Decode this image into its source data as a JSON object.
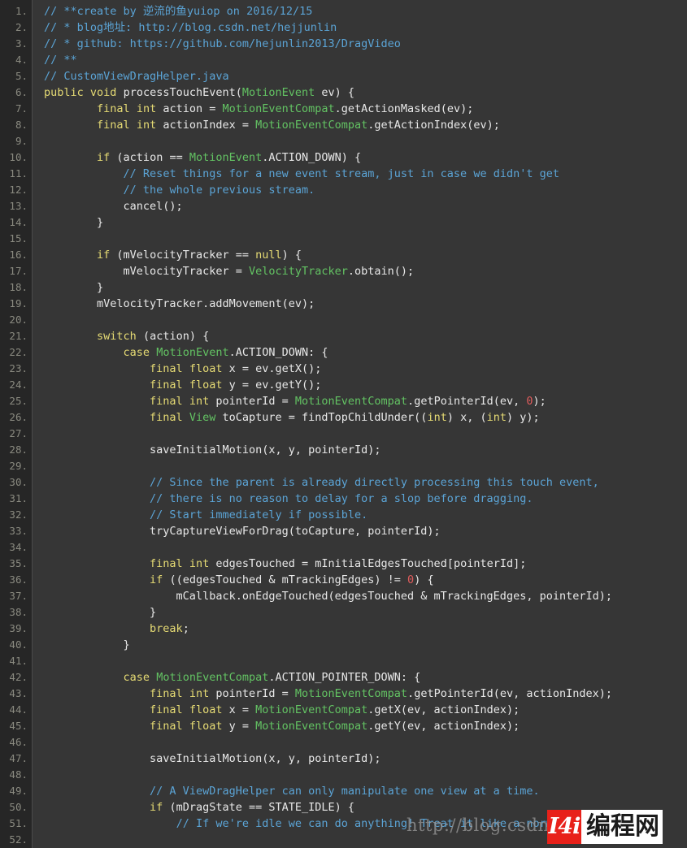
{
  "editor": {
    "title": "CustomViewDragHelper.java",
    "language": "Java",
    "theme": "dark",
    "colors": {
      "background": "#363636",
      "gutter_background": "#262626",
      "gutter_text": "#8a8a80",
      "plain_text": "#e8e8e8",
      "comment": "#5ba4d6",
      "keyword": "#e6db74",
      "type": "#63c363",
      "number": "#e05c5c"
    },
    "first_line_number": 1,
    "last_line_number": 52,
    "total_lines_shown": 52
  },
  "watermark": {
    "url_text": "http://blog.csdn.n",
    "logo_mark": "I4i",
    "logo_text": "编程网",
    "logo_background": "#e8211a"
  },
  "lines": [
    {
      "n": "1.",
      "tokens": [
        {
          "t": "cmt",
          "s": "// **create by 逆流的鱼yuiop on 2016/12/15"
        }
      ]
    },
    {
      "n": "2.",
      "tokens": [
        {
          "t": "cmt",
          "s": "// * blog地址: http://blog.csdn.net/hejjunlin"
        }
      ]
    },
    {
      "n": "3.",
      "tokens": [
        {
          "t": "cmt",
          "s": "// * github: https://github.com/hejunlin2013/DragVideo"
        }
      ]
    },
    {
      "n": "4.",
      "tokens": [
        {
          "t": "cmt",
          "s": "// **"
        }
      ]
    },
    {
      "n": "5.",
      "tokens": [
        {
          "t": "cmt",
          "s": "// CustomViewDragHelper.java"
        }
      ]
    },
    {
      "n": "6.",
      "tokens": [
        {
          "t": "kw",
          "s": "public"
        },
        {
          "t": "pln",
          "s": " "
        },
        {
          "t": "kw",
          "s": "void"
        },
        {
          "t": "pln",
          "s": " processTouchEvent("
        },
        {
          "t": "typ",
          "s": "MotionEvent"
        },
        {
          "t": "pln",
          "s": " ev) {"
        }
      ]
    },
    {
      "n": "7.",
      "tokens": [
        {
          "t": "pln",
          "s": "        "
        },
        {
          "t": "kw",
          "s": "final"
        },
        {
          "t": "pln",
          "s": " "
        },
        {
          "t": "kw",
          "s": "int"
        },
        {
          "t": "pln",
          "s": " action = "
        },
        {
          "t": "typ",
          "s": "MotionEventCompat"
        },
        {
          "t": "pln",
          "s": ".getActionMasked(ev);"
        }
      ]
    },
    {
      "n": "8.",
      "tokens": [
        {
          "t": "pln",
          "s": "        "
        },
        {
          "t": "kw",
          "s": "final"
        },
        {
          "t": "pln",
          "s": " "
        },
        {
          "t": "kw",
          "s": "int"
        },
        {
          "t": "pln",
          "s": " actionIndex = "
        },
        {
          "t": "typ",
          "s": "MotionEventCompat"
        },
        {
          "t": "pln",
          "s": ".getActionIndex(ev);"
        }
      ]
    },
    {
      "n": "9.",
      "tokens": [
        {
          "t": "pln",
          "s": ""
        }
      ]
    },
    {
      "n": "10.",
      "tokens": [
        {
          "t": "pln",
          "s": "        "
        },
        {
          "t": "kw",
          "s": "if"
        },
        {
          "t": "pln",
          "s": " (action == "
        },
        {
          "t": "typ",
          "s": "MotionEvent"
        },
        {
          "t": "pln",
          "s": ".ACTION_DOWN) {"
        }
      ]
    },
    {
      "n": "11.",
      "tokens": [
        {
          "t": "pln",
          "s": "            "
        },
        {
          "t": "cmt",
          "s": "// Reset things for a new event stream, just in case we didn't get"
        }
      ]
    },
    {
      "n": "12.",
      "tokens": [
        {
          "t": "pln",
          "s": "            "
        },
        {
          "t": "cmt",
          "s": "// the whole previous stream."
        }
      ]
    },
    {
      "n": "13.",
      "tokens": [
        {
          "t": "pln",
          "s": "            cancel();"
        }
      ]
    },
    {
      "n": "14.",
      "tokens": [
        {
          "t": "pln",
          "s": "        }"
        }
      ]
    },
    {
      "n": "15.",
      "tokens": [
        {
          "t": "pln",
          "s": ""
        }
      ]
    },
    {
      "n": "16.",
      "tokens": [
        {
          "t": "pln",
          "s": "        "
        },
        {
          "t": "kw",
          "s": "if"
        },
        {
          "t": "pln",
          "s": " (mVelocityTracker == "
        },
        {
          "t": "kw",
          "s": "null"
        },
        {
          "t": "pln",
          "s": ") {"
        }
      ]
    },
    {
      "n": "17.",
      "tokens": [
        {
          "t": "pln",
          "s": "            mVelocityTracker = "
        },
        {
          "t": "typ",
          "s": "VelocityTracker"
        },
        {
          "t": "pln",
          "s": ".obtain();"
        }
      ]
    },
    {
      "n": "18.",
      "tokens": [
        {
          "t": "pln",
          "s": "        }"
        }
      ]
    },
    {
      "n": "19.",
      "tokens": [
        {
          "t": "pln",
          "s": "        mVelocityTracker.addMovement(ev);"
        }
      ]
    },
    {
      "n": "20.",
      "tokens": [
        {
          "t": "pln",
          "s": ""
        }
      ]
    },
    {
      "n": "21.",
      "tokens": [
        {
          "t": "pln",
          "s": "        "
        },
        {
          "t": "kw",
          "s": "switch"
        },
        {
          "t": "pln",
          "s": " (action) {"
        }
      ]
    },
    {
      "n": "22.",
      "tokens": [
        {
          "t": "pln",
          "s": "            "
        },
        {
          "t": "kw",
          "s": "case"
        },
        {
          "t": "pln",
          "s": " "
        },
        {
          "t": "typ",
          "s": "MotionEvent"
        },
        {
          "t": "pln",
          "s": ".ACTION_DOWN: {"
        }
      ]
    },
    {
      "n": "23.",
      "tokens": [
        {
          "t": "pln",
          "s": "                "
        },
        {
          "t": "kw",
          "s": "final"
        },
        {
          "t": "pln",
          "s": " "
        },
        {
          "t": "kw",
          "s": "float"
        },
        {
          "t": "pln",
          "s": " x = ev.getX();"
        }
      ]
    },
    {
      "n": "24.",
      "tokens": [
        {
          "t": "pln",
          "s": "                "
        },
        {
          "t": "kw",
          "s": "final"
        },
        {
          "t": "pln",
          "s": " "
        },
        {
          "t": "kw",
          "s": "float"
        },
        {
          "t": "pln",
          "s": " y = ev.getY();"
        }
      ]
    },
    {
      "n": "25.",
      "tokens": [
        {
          "t": "pln",
          "s": "                "
        },
        {
          "t": "kw",
          "s": "final"
        },
        {
          "t": "pln",
          "s": " "
        },
        {
          "t": "kw",
          "s": "int"
        },
        {
          "t": "pln",
          "s": " pointerId = "
        },
        {
          "t": "typ",
          "s": "MotionEventCompat"
        },
        {
          "t": "pln",
          "s": ".getPointerId(ev, "
        },
        {
          "t": "num",
          "s": "0"
        },
        {
          "t": "pln",
          "s": ");"
        }
      ]
    },
    {
      "n": "26.",
      "tokens": [
        {
          "t": "pln",
          "s": "                "
        },
        {
          "t": "kw",
          "s": "final"
        },
        {
          "t": "pln",
          "s": " "
        },
        {
          "t": "typ",
          "s": "View"
        },
        {
          "t": "pln",
          "s": " toCapture = findTopChildUnder(("
        },
        {
          "t": "kw",
          "s": "int"
        },
        {
          "t": "pln",
          "s": ") x, ("
        },
        {
          "t": "kw",
          "s": "int"
        },
        {
          "t": "pln",
          "s": ") y);"
        }
      ]
    },
    {
      "n": "27.",
      "tokens": [
        {
          "t": "pln",
          "s": ""
        }
      ]
    },
    {
      "n": "28.",
      "tokens": [
        {
          "t": "pln",
          "s": "                saveInitialMotion(x, y, pointerId);"
        }
      ]
    },
    {
      "n": "29.",
      "tokens": [
        {
          "t": "pln",
          "s": ""
        }
      ]
    },
    {
      "n": "30.",
      "tokens": [
        {
          "t": "pln",
          "s": "                "
        },
        {
          "t": "cmt",
          "s": "// Since the parent is already directly processing this touch event,"
        }
      ]
    },
    {
      "n": "31.",
      "tokens": [
        {
          "t": "pln",
          "s": "                "
        },
        {
          "t": "cmt",
          "s": "// there is no reason to delay for a slop before dragging."
        }
      ]
    },
    {
      "n": "32.",
      "tokens": [
        {
          "t": "pln",
          "s": "                "
        },
        {
          "t": "cmt",
          "s": "// Start immediately if possible."
        }
      ]
    },
    {
      "n": "33.",
      "tokens": [
        {
          "t": "pln",
          "s": "                tryCaptureViewForDrag(toCapture, pointerId);"
        }
      ]
    },
    {
      "n": "34.",
      "tokens": [
        {
          "t": "pln",
          "s": ""
        }
      ]
    },
    {
      "n": "35.",
      "tokens": [
        {
          "t": "pln",
          "s": "                "
        },
        {
          "t": "kw",
          "s": "final"
        },
        {
          "t": "pln",
          "s": " "
        },
        {
          "t": "kw",
          "s": "int"
        },
        {
          "t": "pln",
          "s": " edgesTouched = mInitialEdgesTouched[pointerId];"
        }
      ]
    },
    {
      "n": "36.",
      "tokens": [
        {
          "t": "pln",
          "s": "                "
        },
        {
          "t": "kw",
          "s": "if"
        },
        {
          "t": "pln",
          "s": " ((edgesTouched & mTrackingEdges) != "
        },
        {
          "t": "num",
          "s": "0"
        },
        {
          "t": "pln",
          "s": ") {"
        }
      ]
    },
    {
      "n": "37.",
      "tokens": [
        {
          "t": "pln",
          "s": "                    mCallback.onEdgeTouched(edgesTouched & mTrackingEdges, pointerId);"
        }
      ]
    },
    {
      "n": "38.",
      "tokens": [
        {
          "t": "pln",
          "s": "                }"
        }
      ]
    },
    {
      "n": "39.",
      "tokens": [
        {
          "t": "pln",
          "s": "                "
        },
        {
          "t": "kw",
          "s": "break"
        },
        {
          "t": "pln",
          "s": ";"
        }
      ]
    },
    {
      "n": "40.",
      "tokens": [
        {
          "t": "pln",
          "s": "            }"
        }
      ]
    },
    {
      "n": "41.",
      "tokens": [
        {
          "t": "pln",
          "s": ""
        }
      ]
    },
    {
      "n": "42.",
      "tokens": [
        {
          "t": "pln",
          "s": "            "
        },
        {
          "t": "kw",
          "s": "case"
        },
        {
          "t": "pln",
          "s": " "
        },
        {
          "t": "typ",
          "s": "MotionEventCompat"
        },
        {
          "t": "pln",
          "s": ".ACTION_POINTER_DOWN: {"
        }
      ]
    },
    {
      "n": "43.",
      "tokens": [
        {
          "t": "pln",
          "s": "                "
        },
        {
          "t": "kw",
          "s": "final"
        },
        {
          "t": "pln",
          "s": " "
        },
        {
          "t": "kw",
          "s": "int"
        },
        {
          "t": "pln",
          "s": " pointerId = "
        },
        {
          "t": "typ",
          "s": "MotionEventCompat"
        },
        {
          "t": "pln",
          "s": ".getPointerId(ev, actionIndex);"
        }
      ]
    },
    {
      "n": "44.",
      "tokens": [
        {
          "t": "pln",
          "s": "                "
        },
        {
          "t": "kw",
          "s": "final"
        },
        {
          "t": "pln",
          "s": " "
        },
        {
          "t": "kw",
          "s": "float"
        },
        {
          "t": "pln",
          "s": " x = "
        },
        {
          "t": "typ",
          "s": "MotionEventCompat"
        },
        {
          "t": "pln",
          "s": ".getX(ev, actionIndex);"
        }
      ]
    },
    {
      "n": "45.",
      "tokens": [
        {
          "t": "pln",
          "s": "                "
        },
        {
          "t": "kw",
          "s": "final"
        },
        {
          "t": "pln",
          "s": " "
        },
        {
          "t": "kw",
          "s": "float"
        },
        {
          "t": "pln",
          "s": " y = "
        },
        {
          "t": "typ",
          "s": "MotionEventCompat"
        },
        {
          "t": "pln",
          "s": ".getY(ev, actionIndex);"
        }
      ]
    },
    {
      "n": "46.",
      "tokens": [
        {
          "t": "pln",
          "s": ""
        }
      ]
    },
    {
      "n": "47.",
      "tokens": [
        {
          "t": "pln",
          "s": "                saveInitialMotion(x, y, pointerId);"
        }
      ]
    },
    {
      "n": "48.",
      "tokens": [
        {
          "t": "pln",
          "s": ""
        }
      ]
    },
    {
      "n": "49.",
      "tokens": [
        {
          "t": "pln",
          "s": "                "
        },
        {
          "t": "cmt",
          "s": "// A ViewDragHelper can only manipulate one view at a time."
        }
      ]
    },
    {
      "n": "50.",
      "tokens": [
        {
          "t": "pln",
          "s": "                "
        },
        {
          "t": "kw",
          "s": "if"
        },
        {
          "t": "pln",
          "s": " (mDragState == STATE_IDLE) {"
        }
      ]
    },
    {
      "n": "51.",
      "tokens": [
        {
          "t": "pln",
          "s": "                    "
        },
        {
          "t": "cmt",
          "s": "// If we're idle we can do anything! Treat it like a normal down"
        }
      ]
    },
    {
      "n": "52.",
      "tokens": [
        {
          "t": "pln",
          "s": ""
        }
      ]
    }
  ]
}
